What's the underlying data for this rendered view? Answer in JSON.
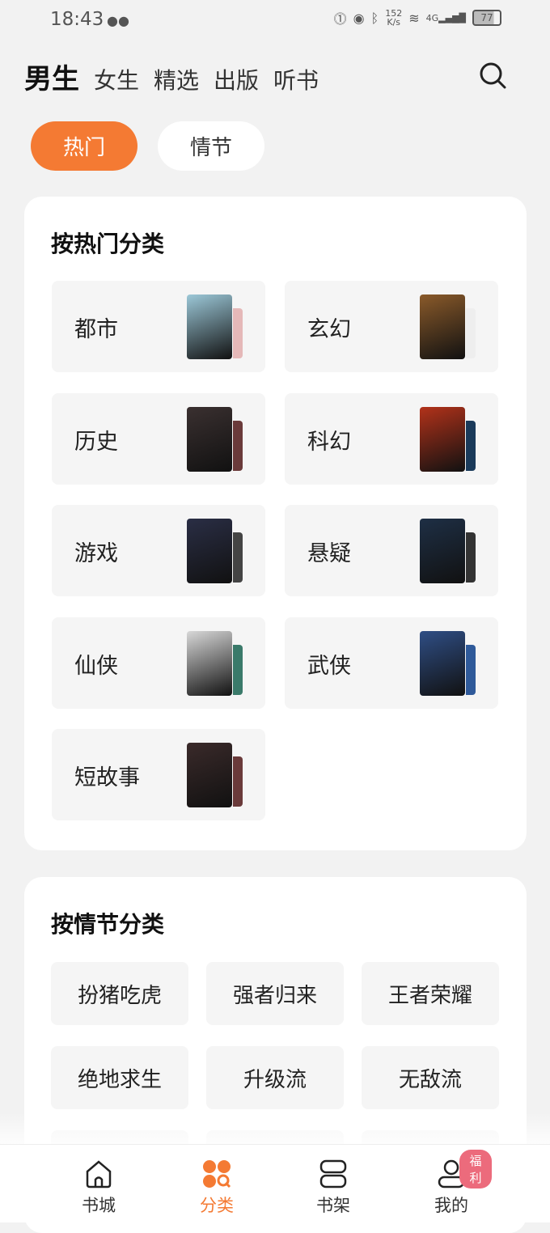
{
  "status": {
    "time": "18:43",
    "speed_value": "152",
    "speed_unit": "K/s",
    "network": "4G",
    "battery": "77"
  },
  "top_tabs": [
    {
      "label": "男生",
      "active": true
    },
    {
      "label": "女生"
    },
    {
      "label": "精选"
    },
    {
      "label": "出版"
    },
    {
      "label": "听书"
    }
  ],
  "pills": [
    {
      "label": "热门",
      "active": true
    },
    {
      "label": "情节"
    }
  ],
  "hot": {
    "title": "按热门分类",
    "items": [
      {
        "label": "都市",
        "cover": "#9cc8d8",
        "back": "#e5b8b8"
      },
      {
        "label": "玄幻",
        "cover": "#8a5a2a",
        "back": "#eee"
      },
      {
        "label": "历史",
        "cover": "#3a3030",
        "back": "#6a3a3a"
      },
      {
        "label": "科幻",
        "cover": "#b2321a",
        "back": "#1a3a5a"
      },
      {
        "label": "游戏",
        "cover": "#2a2e45",
        "back": "#444"
      },
      {
        "label": "悬疑",
        "cover": "#1e2f45",
        "back": "#333"
      },
      {
        "label": "仙侠",
        "cover": "#d8d8d8",
        "back": "#3a7a6a"
      },
      {
        "label": "武侠",
        "cover": "#2f4e85",
        "back": "#2f5a9a"
      },
      {
        "label": "短故事",
        "cover": "#3a2a2a",
        "back": "#6a3a3a"
      }
    ]
  },
  "plot": {
    "title": "按情节分类",
    "items": [
      "扮猪吃虎",
      "强者归来",
      "王者荣耀",
      "绝地求生",
      "升级流",
      "无敌流"
    ]
  },
  "nav": {
    "items": [
      {
        "label": "书城"
      },
      {
        "label": "分类",
        "active": true
      },
      {
        "label": "书架"
      },
      {
        "label": "我的",
        "badge": "福利"
      }
    ]
  },
  "colors": {
    "accent": "#f47a33",
    "badge": "#ec6b7c"
  }
}
